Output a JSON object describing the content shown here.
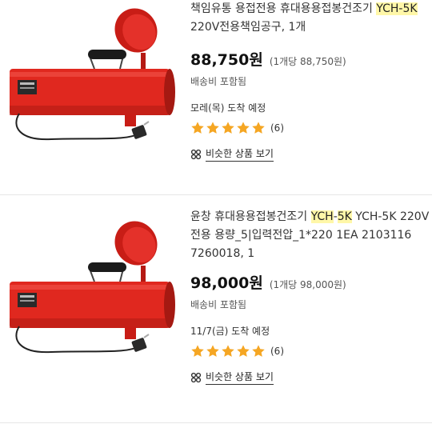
{
  "products": [
    {
      "title_pre": "책임유통 용접전용 휴대용용접봉건조기 ",
      "title_hl1": "YCH",
      "title_mid": "",
      "title_hl2": "-5K",
      "title_post": " 220V전용책임공구, 1개",
      "price": "88,750원",
      "unit_price": "(1개당 88,750원)",
      "shipping": "배송비 포함됨",
      "arrival": "모레(목) 도착 예정",
      "rating_stars": 5,
      "review_count": "(6)",
      "similar_label": "비슷한 상품 보기"
    },
    {
      "title_pre": "윤창 휴대용용접봉건조기 ",
      "title_hl1": "YCH",
      "title_mid": "-",
      "title_hl2": "5K",
      "title_post": " YCH-5K 220V전용 용량_5|입력전압_1*220 1EA 2103116 7260018, 1",
      "price": "98,000원",
      "unit_price": "(1개당 98,000원)",
      "shipping": "배송비 포함됨",
      "arrival": "11/7(금) 도착 예정",
      "rating_stars": 5,
      "review_count": "(6)",
      "similar_label": "비슷한 상품 보기"
    }
  ],
  "colors": {
    "highlight": "#fff7a8",
    "star": "#f5a623",
    "product_red": "#e0281f"
  },
  "icons": {
    "rating": "star-icon",
    "similar": "similar-products-icon"
  }
}
